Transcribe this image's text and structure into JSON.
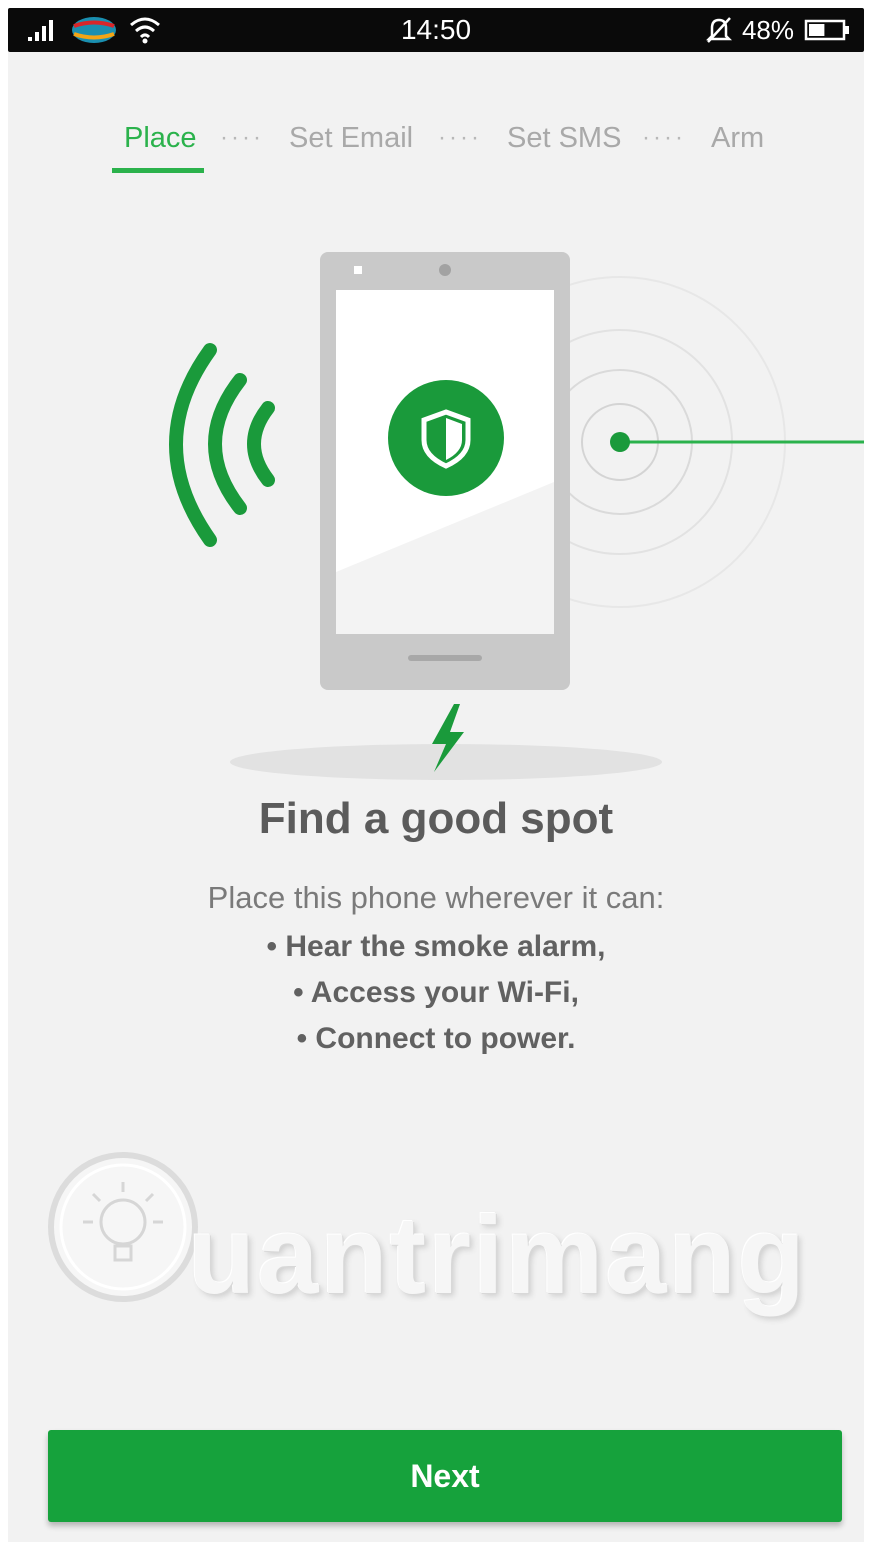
{
  "status_bar": {
    "time": "14:50",
    "battery_percent": "48%",
    "battery_level": 0.48,
    "icons": [
      "signal-icon",
      "network-logo-icon",
      "wifi-icon",
      "alarm-off-icon",
      "battery-icon"
    ]
  },
  "steps": [
    {
      "label": "Place",
      "active": true
    },
    {
      "label": "Set Email",
      "active": false
    },
    {
      "label": "Set SMS",
      "active": false
    },
    {
      "label": "Arm",
      "active": false
    }
  ],
  "step_separator": "····",
  "illustration": {
    "icons": [
      "sound-waves-icon",
      "phone-icon",
      "shield-icon",
      "smoke-alarm-icon",
      "lightning-icon"
    ]
  },
  "content": {
    "title": "Find a good spot",
    "description": "Place this phone wherever it can:",
    "bullets": [
      "• Hear the smoke alarm,",
      "• Access your Wi-Fi,",
      "• Connect to power."
    ]
  },
  "watermark": "uantrimang",
  "next_button": "Next",
  "colors": {
    "accent": "#2bb24c",
    "button": "#16a23c",
    "background": "#f2f2f2"
  }
}
